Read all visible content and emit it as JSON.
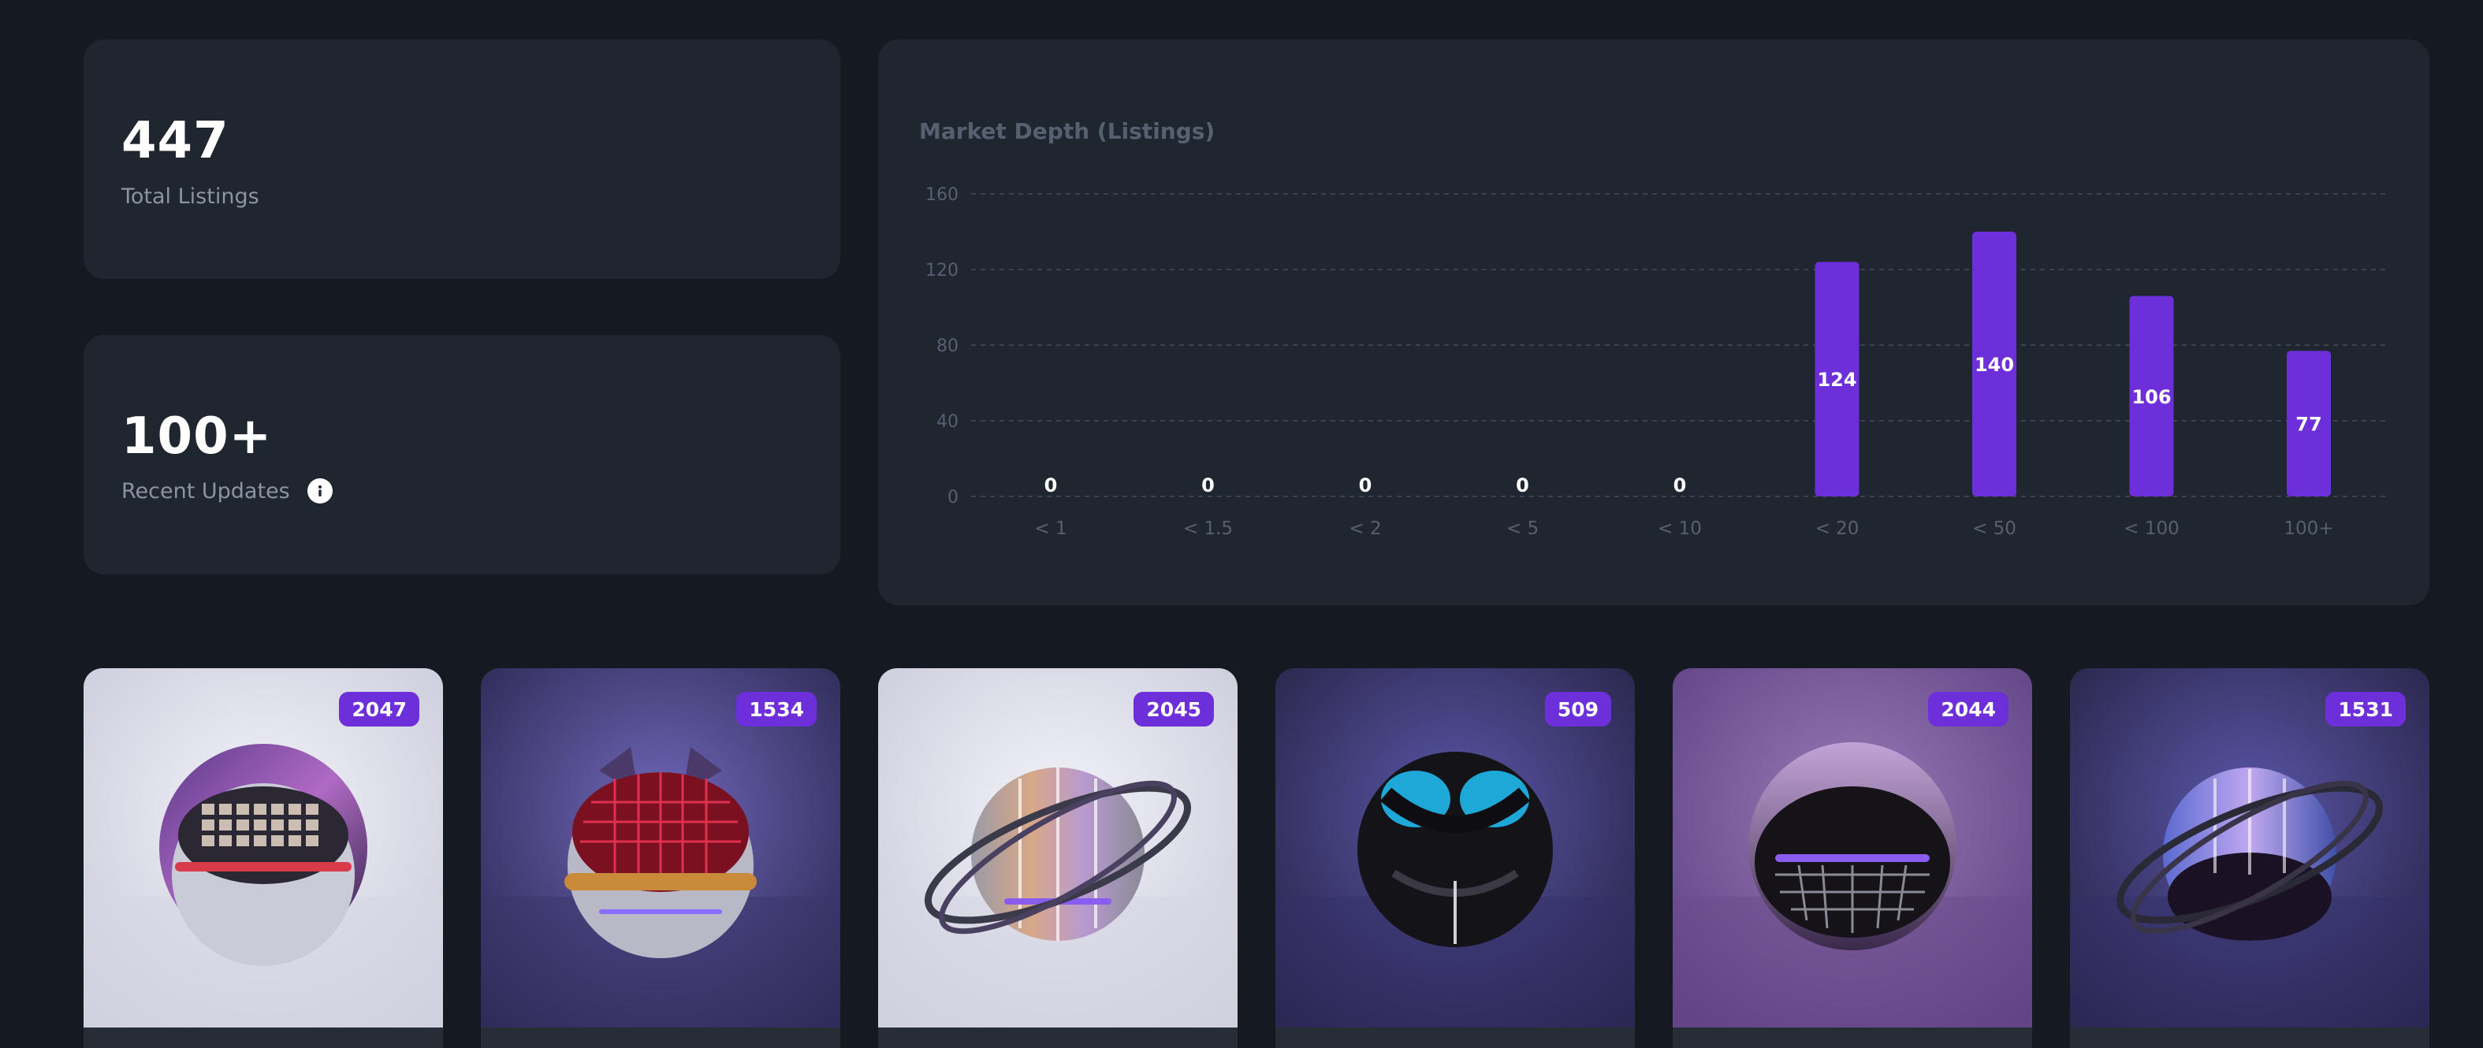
{
  "stats": {
    "total_listings": {
      "value": "447",
      "label": "Total Listings"
    },
    "recent_updates": {
      "value": "100+",
      "label": "Recent Updates",
      "icon": "info-icon"
    }
  },
  "colors": {
    "background": "#151a20",
    "card": "#1f262f",
    "accent": "#6d2fd9",
    "muted_text": "#8a94a3",
    "axis_text": "#566070"
  },
  "chart_data": {
    "type": "bar",
    "title": "Market Depth (Listings)",
    "categories": [
      "< 1",
      "< 1.5",
      "< 2",
      "< 5",
      "< 10",
      "< 20",
      "< 50",
      "< 100",
      "100+"
    ],
    "values": [
      0,
      0,
      0,
      0,
      0,
      124,
      140,
      106,
      77
    ],
    "yticks": [
      0,
      40,
      80,
      120,
      160
    ],
    "ylim": [
      0,
      160
    ],
    "grid": true,
    "data_labels": true
  },
  "nfts": [
    {
      "id": "2047",
      "theme": "light-visor-red"
    },
    {
      "id": "1534",
      "theme": "dark-cat-red"
    },
    {
      "id": "2045",
      "theme": "light-rings-gold"
    },
    {
      "id": "509",
      "theme": "dark-goggles-black"
    },
    {
      "id": "2044",
      "theme": "purple-visor-grid"
    },
    {
      "id": "1531",
      "theme": "dark-rings-blue"
    }
  ]
}
